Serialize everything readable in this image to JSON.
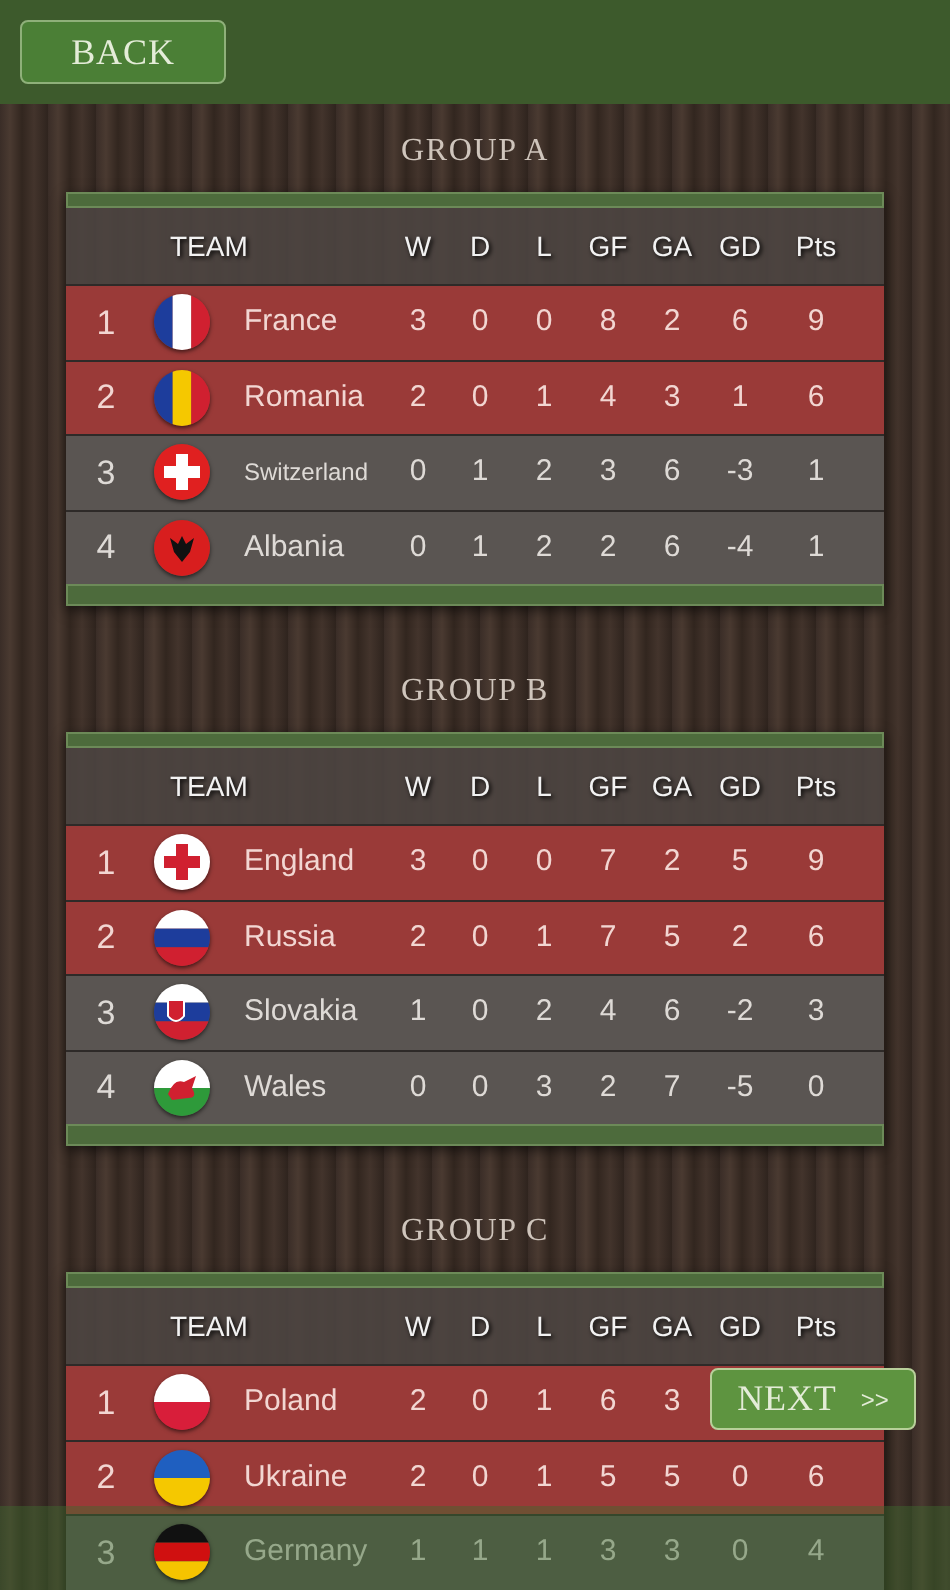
{
  "back_button": {
    "label": "BACK"
  },
  "groups": [
    {
      "title": "GROUP A",
      "columns": [
        "TEAM",
        "W",
        "D",
        "L",
        "GF",
        "GA",
        "GD",
        "Pts"
      ],
      "rows": [
        {
          "rank": "1",
          "team": "France",
          "flag": {
            "kind": "vertical",
            "parts": [
              {
                "color": "#1d3d9c"
              },
              {
                "color": "#ffffff"
              },
              {
                "color": "#d02030"
              }
            ]
          },
          "highlighted": true,
          "stats": [
            "3",
            "0",
            "0",
            "8",
            "2",
            "6",
            "9"
          ]
        },
        {
          "rank": "2",
          "team": "Romania",
          "flag": {
            "kind": "vertical",
            "parts": [
              {
                "color": "#1d3d9c"
              },
              {
                "color": "#f5c800"
              },
              {
                "color": "#d02030"
              }
            ]
          },
          "highlighted": true,
          "stats": [
            "2",
            "0",
            "1",
            "4",
            "3",
            "1",
            "6"
          ]
        },
        {
          "rank": "3",
          "team": "Switzerland",
          "flag": {
            "kind": "cross",
            "parts": [
              {
                "color": "#e02020"
              },
              {
                "color": "#ffffff"
              }
            ]
          },
          "highlighted": false,
          "stats": [
            "0",
            "1",
            "2",
            "3",
            "6",
            "-3",
            "1"
          ]
        },
        {
          "rank": "4",
          "team": "Albania",
          "flag": {
            "kind": "emblem",
            "parts": [
              {
                "color": "#d81e1e"
              },
              {
                "color": "#111111"
              }
            ]
          },
          "highlighted": false,
          "stats": [
            "0",
            "1",
            "2",
            "2",
            "6",
            "-4",
            "1"
          ]
        }
      ]
    },
    {
      "title": "GROUP B",
      "columns": [
        "TEAM",
        "W",
        "D",
        "L",
        "GF",
        "GA",
        "GD",
        "Pts"
      ],
      "rows": [
        {
          "rank": "1",
          "team": "England",
          "flag": {
            "kind": "cross",
            "parts": [
              {
                "color": "#ffffff"
              },
              {
                "color": "#d02030"
              }
            ]
          },
          "highlighted": true,
          "stats": [
            "3",
            "0",
            "0",
            "7",
            "2",
            "5",
            "9"
          ]
        },
        {
          "rank": "2",
          "team": "Russia",
          "flag": {
            "kind": "horizontal",
            "parts": [
              {
                "color": "#ffffff"
              },
              {
                "color": "#1d3d9c"
              },
              {
                "color": "#d02030"
              }
            ]
          },
          "highlighted": true,
          "stats": [
            "2",
            "0",
            "1",
            "7",
            "5",
            "2",
            "6"
          ]
        },
        {
          "rank": "3",
          "team": "Slovakia",
          "flag": {
            "kind": "horizontal-shield",
            "parts": [
              {
                "color": "#ffffff"
              },
              {
                "color": "#1d3d9c"
              },
              {
                "color": "#d02030"
              }
            ]
          },
          "highlighted": false,
          "stats": [
            "1",
            "0",
            "2",
            "4",
            "6",
            "-2",
            "3"
          ]
        },
        {
          "rank": "4",
          "team": "Wales",
          "flag": {
            "kind": "emblem-split",
            "parts": [
              {
                "color": "#ffffff"
              },
              {
                "color": "#2e9a3a"
              },
              {
                "color": "#d02030"
              }
            ]
          },
          "highlighted": false,
          "stats": [
            "0",
            "0",
            "3",
            "2",
            "7",
            "-5",
            "0"
          ]
        }
      ]
    },
    {
      "title": "GROUP C",
      "columns": [
        "TEAM",
        "W",
        "D",
        "L",
        "GF",
        "GA",
        "GD",
        "Pts"
      ],
      "rows": [
        {
          "rank": "1",
          "team": "Poland",
          "flag": {
            "kind": "horizontal",
            "parts": [
              {
                "color": "#ffffff"
              },
              {
                "color": "#d81e3a"
              }
            ]
          },
          "highlighted": true,
          "stats": [
            "2",
            "0",
            "1",
            "6",
            "3"
          ]
        },
        {
          "rank": "2",
          "team": "Ukraine",
          "flag": {
            "kind": "horizontal",
            "parts": [
              {
                "color": "#1f5fc0"
              },
              {
                "color": "#f5c800"
              }
            ]
          },
          "highlighted": true,
          "stats": [
            "2",
            "0",
            "1",
            "5",
            "5",
            "0",
            "6"
          ]
        },
        {
          "rank": "3",
          "team": "Germany",
          "flag": {
            "kind": "horizontal",
            "parts": [
              {
                "color": "#111111"
              },
              {
                "color": "#d01010"
              },
              {
                "color": "#f5c400"
              }
            ]
          },
          "highlighted": false,
          "stats": [
            "1",
            "1",
            "1",
            "3",
            "3",
            "0",
            "4"
          ]
        }
      ]
    }
  ],
  "next_button": {
    "label": "NEXT",
    "arrow": ">>"
  }
}
